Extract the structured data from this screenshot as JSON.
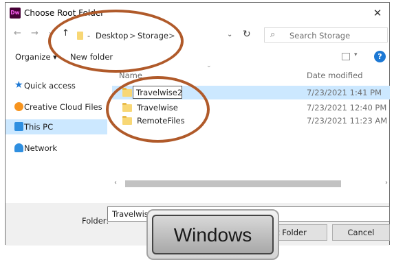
{
  "window": {
    "app_icon": "Dw",
    "title": "Choose Root Folder",
    "close": "✕"
  },
  "navbar": {
    "back": "←",
    "forward": "→",
    "up": "↑",
    "recent": "⌄",
    "crumbs": [
      "Desktop",
      "Storage"
    ],
    "separator": ">",
    "dropdown": "⌄",
    "refresh": "↻",
    "search_placeholder": "Search Storage"
  },
  "toolbar": {
    "organize": "Organize ▾",
    "new_folder": "New folder",
    "view_drop": "▾",
    "help": "?"
  },
  "sidebar": {
    "items": [
      {
        "label": "Quick access",
        "icon": "star-icon"
      },
      {
        "label": "Creative Cloud Files",
        "icon": "creative-cloud-icon"
      },
      {
        "label": "This PC",
        "icon": "computer-icon",
        "selected": true
      },
      {
        "label": "Network",
        "icon": "network-icon"
      }
    ]
  },
  "file_list": {
    "columns": {
      "name": "Name",
      "date": "Date modified"
    },
    "sort_indicator": "⌄",
    "rows": [
      {
        "name": "Travelwise2",
        "date": "7/23/2021 1:41 PM",
        "selected": true,
        "renaming": true
      },
      {
        "name": "Travelwise",
        "date": "7/23/2021 12:40 PM"
      },
      {
        "name": "RemoteFiles",
        "date": "7/23/2021 11:23 AM"
      }
    ]
  },
  "scrollbar": {
    "left": "‹",
    "right": "›"
  },
  "bottom": {
    "folder_label": "Folder:",
    "folder_value": "Travelwise2",
    "select_button": "Select Folder",
    "cancel_button": "Cancel"
  },
  "overlay": {
    "badge_text": "Windows",
    "annotation_color": "#b05a2a"
  },
  "colors": {
    "selection": "#cce8ff",
    "accent": "#1c78d4",
    "folder": "#f8d775"
  }
}
